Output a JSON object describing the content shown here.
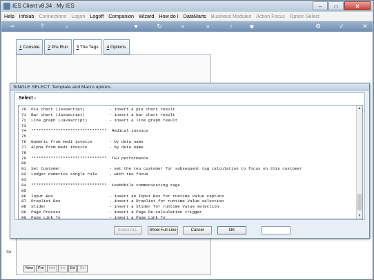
{
  "window": {
    "title": "IES Client v8.34 : My IES",
    "minimize_glyph": "–",
    "maximize_glyph": "□",
    "close_glyph": "✕"
  },
  "menubar": [
    {
      "label": "Help",
      "enabled": true
    },
    {
      "label": "Infolab",
      "enabled": true
    },
    {
      "label": "Connections",
      "enabled": false
    },
    {
      "label": "Logon",
      "enabled": false
    },
    {
      "label": "Logoff",
      "enabled": true
    },
    {
      "label": "Companion",
      "enabled": true
    },
    {
      "label": "Wizard",
      "enabled": true
    },
    {
      "label": "How do I",
      "enabled": true
    },
    {
      "label": "DataMarts",
      "enabled": true
    },
    {
      "label": "Business Modules",
      "enabled": false
    },
    {
      "label": "Action Focus",
      "enabled": false
    },
    {
      "label": "Option Select",
      "enabled": false
    }
  ],
  "toolbar_icons": [
    {
      "name": "key-icon",
      "glyph": "⊸"
    },
    {
      "name": "help-icon",
      "glyph": "?"
    },
    {
      "name": "search-icon",
      "glyph": "⌕"
    },
    {
      "name": "heart-icon",
      "glyph": "♥"
    },
    {
      "name": "refresh-icon",
      "glyph": "↻"
    },
    {
      "name": "rewind-icon",
      "glyph": "«"
    },
    {
      "name": "fast-forward-icon",
      "glyph": "»"
    },
    {
      "name": "up-icon",
      "glyph": "↑"
    },
    {
      "name": "stop-icon",
      "glyph": "■"
    },
    {
      "name": "gear-icon",
      "glyph": "⚙"
    },
    {
      "name": "check-icon",
      "glyph": "✓"
    },
    {
      "name": "close-icon",
      "glyph": "✕"
    }
  ],
  "tabs": [
    {
      "num": "1",
      "label": " Console",
      "active": false
    },
    {
      "num": "2",
      "label": " Pre Run",
      "active": false
    },
    {
      "num": "3",
      "label": " The Tags",
      "active": true
    },
    {
      "num": "4",
      "label": " Options",
      "active": false
    }
  ],
  "background": {
    "label": "Se",
    "buttons": [
      {
        "label": "New",
        "enabled": true
      },
      {
        "label": "Pre",
        "enabled": true
      },
      {
        "label": "Add",
        "enabled": false
      },
      {
        "label": "Ins",
        "enabled": false
      },
      {
        "label": "Ed",
        "enabled": true
      },
      {
        "label": "Del",
        "enabled": false
      }
    ]
  },
  "dialog": {
    "title": "SINGLE SELECT: Template and Macro options",
    "heading": "Select -",
    "lines": [
      "70  Pie chart (Javascript)          - insert a pie chart result",
      "71  Bar chart (Javascript)          - insert a bar chart result",
      "72  Line graph (Javascript)         - insert a line graph result",
      "73",
      "74  *******************************  Medical invoice",
      "75",
      "76  Numeric from medi invoice       - by data name",
      "77  Alpha from medi invoice         - by data name",
      "78",
      "79  *******************************  TEU performance",
      "80",
      "81  Set Customer                    - set the teu customer for subsequent tag calculation to focus on this customer",
      "82  Ledger numerics single rule     - with teu focus",
      "83",
      "84  *******************************  iesMobile communicating tags",
      "85",
      "86  Input Box                       - insert an Input Box for runtime Value capture",
      "87  Droplist Box                    - insert a Droplist for runtime Value selection",
      "88  Slider                          - insert a Slider for runtime Value selection",
      "89  Page Process                    - insert a Page Re-calculation trigger",
      "90  Page Link To                    - insert a Page Link To"
    ],
    "buttons": {
      "select_all": "Select ALL",
      "show_full_line": "Show Full Line",
      "cancel": "Cancel",
      "ok": "OK"
    },
    "input_value": ""
  }
}
